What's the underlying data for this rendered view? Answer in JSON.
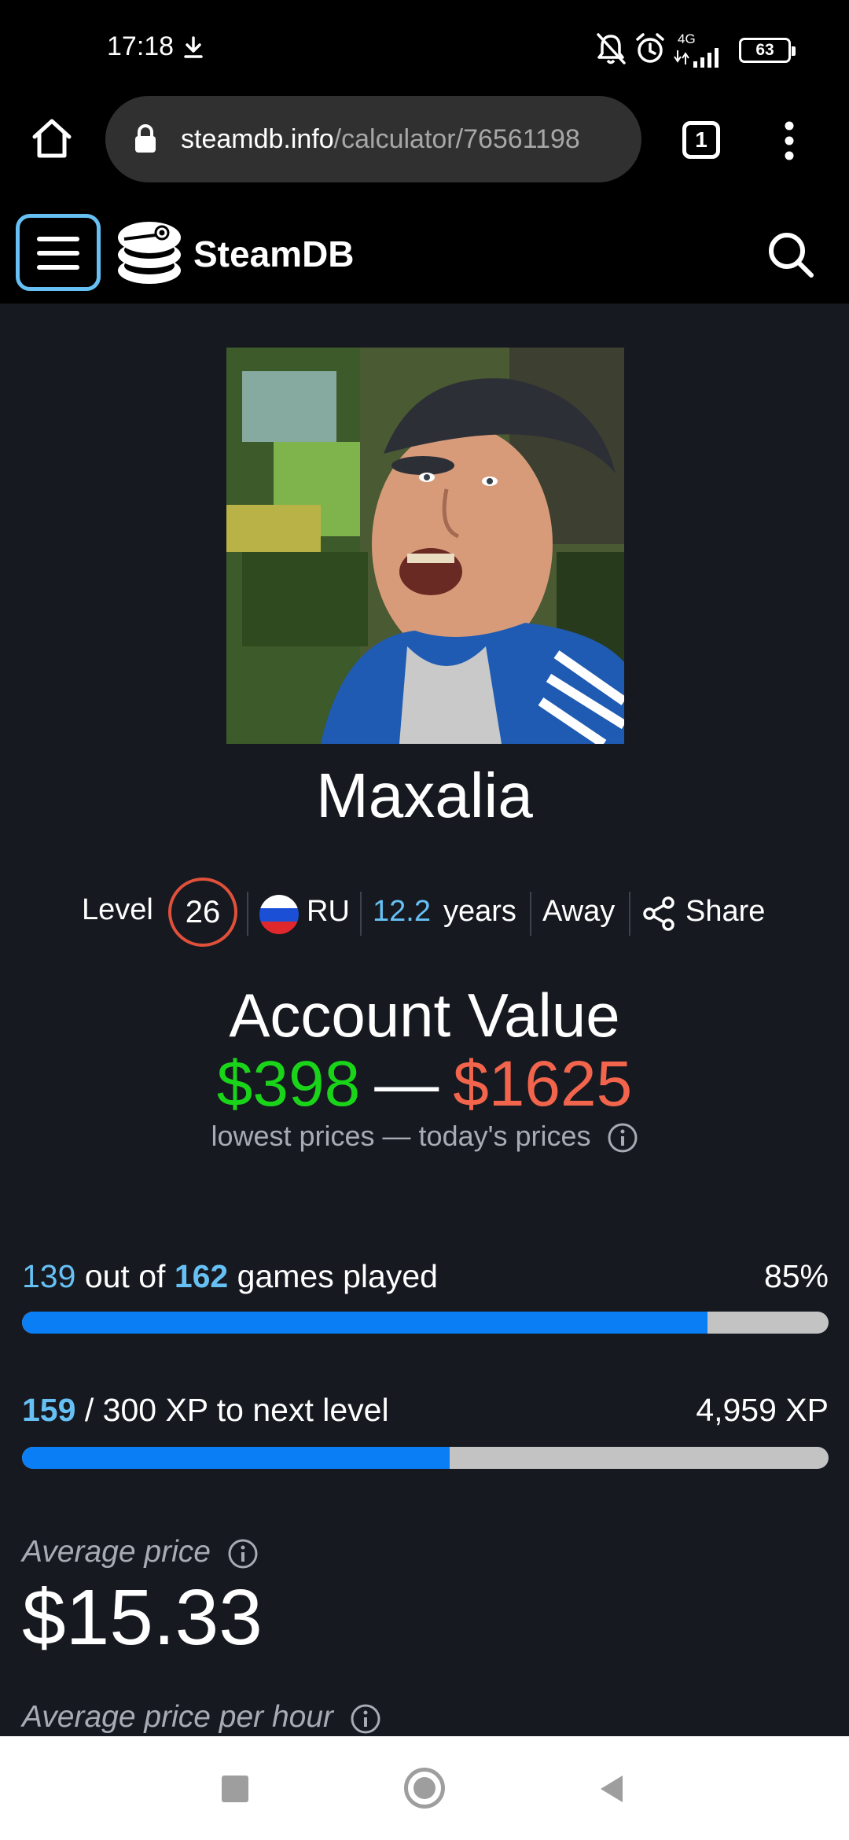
{
  "status_bar": {
    "time": "17:18",
    "network": "4G",
    "battery": "63"
  },
  "browser": {
    "url_host": "steamdb.info",
    "url_path": "/calculator/76561198",
    "tab_count": "1"
  },
  "site": {
    "brand": "SteamDB"
  },
  "profile": {
    "name": "Maxalia",
    "level_label": "Level",
    "level": "26",
    "country": "RU",
    "years_value": "12.2",
    "years_word": "years",
    "status": "Away",
    "share_label": "Share"
  },
  "account_value": {
    "title": "Account Value",
    "low": "$398",
    "separator": "—",
    "high": "$1625",
    "caption": "lowest prices — today's prices"
  },
  "games": {
    "played": "139",
    "out_of_text": "out of",
    "total": "162",
    "suffix": "games played",
    "percent_text": "85%",
    "progress": 0.85
  },
  "xp": {
    "current": "159",
    "separator": "/",
    "target_text": "300 XP to next level",
    "total_text": "4,959 XP",
    "progress": 0.53
  },
  "stats": {
    "avg_price_label": "Average price",
    "avg_price_value": "$15.33",
    "avg_price_hour_label": "Average price per hour"
  },
  "colors": {
    "accent_blue": "#66c0f4",
    "progress_blue": "#0a7ef5",
    "low_value_green": "#1ad41a",
    "high_value_red": "#f2654c",
    "level_ring": "#e0503a"
  }
}
